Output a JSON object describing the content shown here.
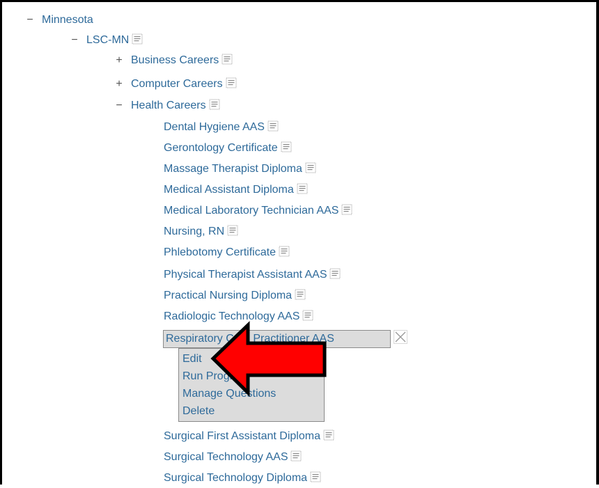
{
  "tree": {
    "root": {
      "label": "Minnesota",
      "toggle": "−"
    },
    "org": {
      "label": "LSC-MN",
      "toggle": "−"
    },
    "categories": [
      {
        "label": "Business Careers",
        "toggle": "+"
      },
      {
        "label": "Computer Careers",
        "toggle": "+"
      },
      {
        "label": "Health Careers",
        "toggle": "−"
      }
    ],
    "programs_before": [
      "Dental Hygiene AAS",
      "Gerontology Certificate",
      "Massage Therapist Diploma",
      "Medical Assistant Diploma",
      "Medical Laboratory Technician AAS",
      "Nursing, RN",
      "Phlebotomy Certificate",
      "Physical Therapist Assistant AAS",
      "Practical Nursing Diploma",
      "Radiologic Technology AAS"
    ],
    "selected_program": "Respiratory Care Practitioner AAS",
    "programs_after": [
      "Surgical First Assistant Diploma",
      "Surgical Technology AAS",
      "Surgical Technology Diploma"
    ]
  },
  "context_menu": {
    "items": [
      "Edit",
      "Run Program",
      "Manage Questions",
      "Delete"
    ]
  },
  "colors": {
    "link": "#2e6a9a",
    "arrow": "#ff0000"
  },
  "icons": {
    "doc": "document-icon",
    "close": "close-icon",
    "pointer": "red-arrow-icon"
  }
}
